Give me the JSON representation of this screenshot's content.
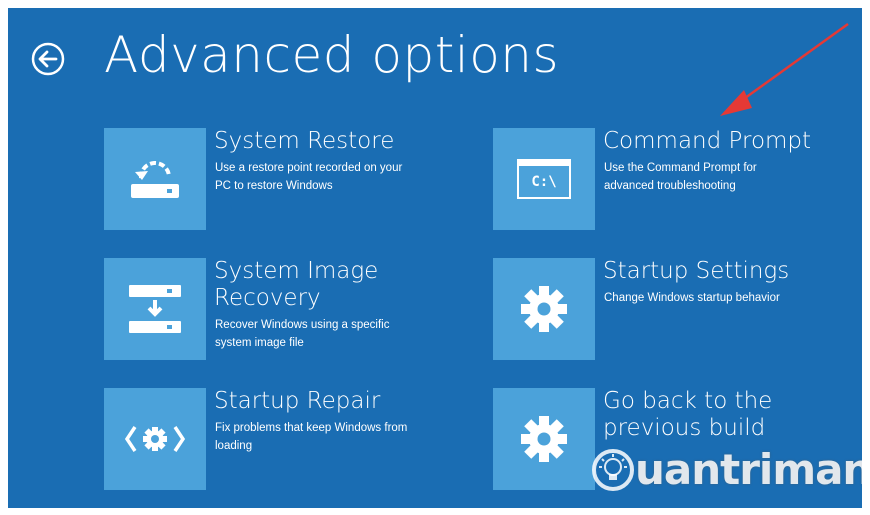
{
  "header": {
    "back_icon": "back-arrow-circle-icon",
    "title": "Advanced options"
  },
  "options": [
    {
      "title": "System Restore",
      "description": "Use a restore point recorded on your\nPC to restore Windows",
      "icon": "system-restore-icon"
    },
    {
      "title": "Command Prompt",
      "description": "Use the Command Prompt for\nadvanced troubleshooting",
      "icon": "command-prompt-icon",
      "icon_text": "C:\\"
    },
    {
      "title": "System Image\nRecovery",
      "description": "Recover Windows using a specific\nsystem image file",
      "icon": "system-image-icon"
    },
    {
      "title": "Startup Settings",
      "description": "Change Windows startup behavior",
      "icon": "gear-icon"
    },
    {
      "title": "Startup Repair",
      "description": "Fix problems that keep Windows from\nloading",
      "icon": "startup-repair-icon"
    },
    {
      "title": "Go back to the\nprevious build",
      "description": "",
      "icon": "gear-icon"
    }
  ],
  "watermark": {
    "text": "uantrimang",
    "icon": "lightbulb-icon"
  },
  "annotation": {
    "icon": "red-arrow-icon",
    "color": "#e53935"
  },
  "colors": {
    "background": "#1a6db3",
    "tile": "#4ba2da",
    "text": "#ffffff"
  }
}
